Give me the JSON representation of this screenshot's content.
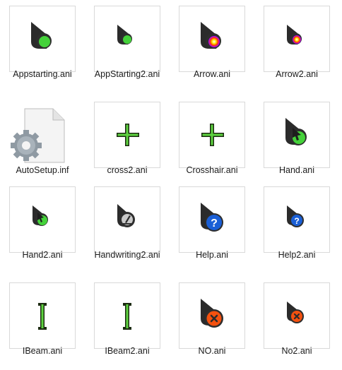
{
  "files": [
    {
      "name": "Appstarting.ani",
      "icon": "busy-pointer-green-dot-icon"
    },
    {
      "name": "AppStarting2.ani",
      "icon": "busy-pointer-green-dot-small-icon"
    },
    {
      "name": "Arrow.ani",
      "icon": "pointer-rainbow-dot-icon"
    },
    {
      "name": "Arrow2.ani",
      "icon": "pointer-rainbow-dot-small-icon"
    },
    {
      "name": "AutoSetup.inf",
      "icon": "settings-file-gear-icon"
    },
    {
      "name": "cross2.ani",
      "icon": "crosshair-green-icon"
    },
    {
      "name": "Crosshair.ani",
      "icon": "crosshair-green-icon"
    },
    {
      "name": "Hand.ani",
      "icon": "hand-pointer-green-icon"
    },
    {
      "name": "Hand2.ani",
      "icon": "hand-pointer-green-small-icon"
    },
    {
      "name": "Handwriting2.ani",
      "icon": "handwriting-pen-icon"
    },
    {
      "name": "Help.ani",
      "icon": "help-question-icon"
    },
    {
      "name": "Help2.ani",
      "icon": "help-question-small-icon"
    },
    {
      "name": "IBeam.ani",
      "icon": "ibeam-text-cursor-icon"
    },
    {
      "name": "IBeam2.ani",
      "icon": "ibeam-text-cursor-icon"
    },
    {
      "name": "NO.ani",
      "icon": "unavailable-no-icon"
    },
    {
      "name": "No2.ani",
      "icon": "unavailable-no-small-icon"
    }
  ]
}
